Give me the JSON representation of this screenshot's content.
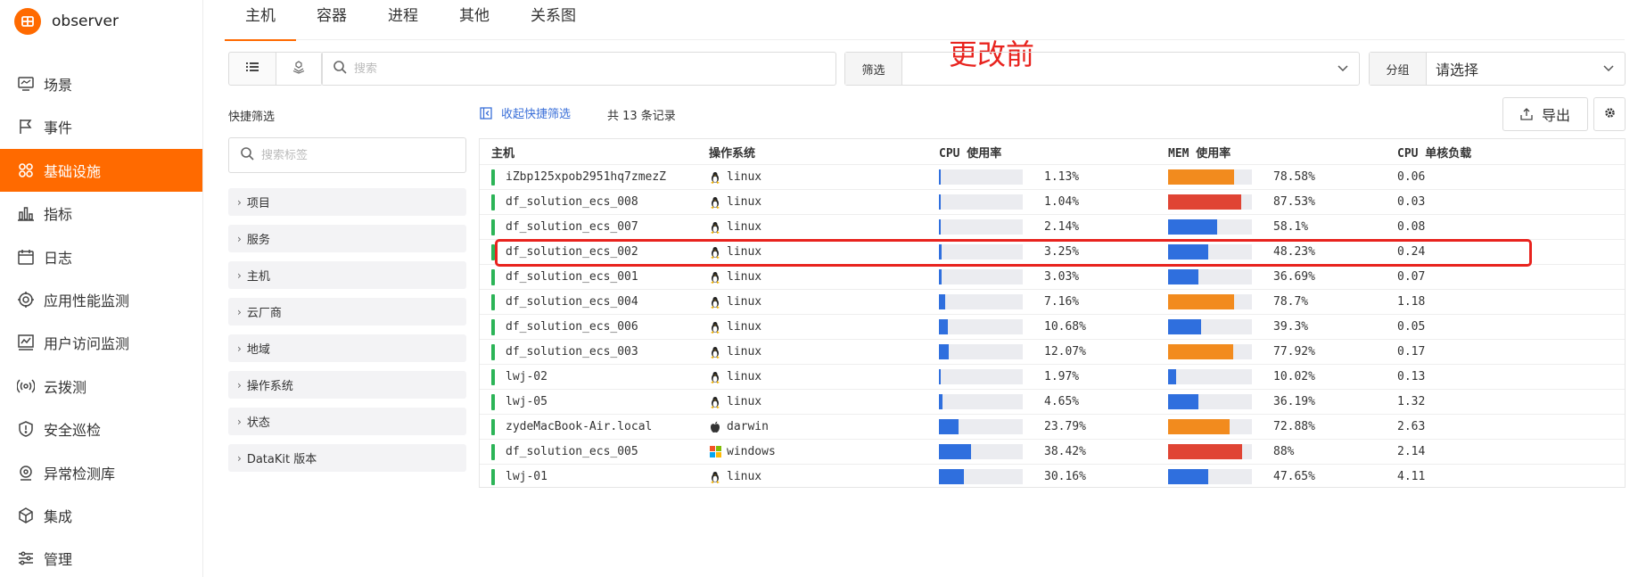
{
  "app": {
    "title": "observer"
  },
  "annotation": "更改前",
  "sidebar": {
    "items": [
      {
        "label": "场景",
        "icon": "monitor-icon",
        "active": false
      },
      {
        "label": "事件",
        "icon": "flag-icon",
        "active": false
      },
      {
        "label": "基础设施",
        "icon": "grid-icon",
        "active": true
      },
      {
        "label": "指标",
        "icon": "bar-chart-icon",
        "active": false
      },
      {
        "label": "日志",
        "icon": "calendar-icon",
        "active": false
      },
      {
        "label": "应用性能监测",
        "icon": "target-icon",
        "active": false
      },
      {
        "label": "用户访问监测",
        "icon": "chart-screen-icon",
        "active": false
      },
      {
        "label": "云拨测",
        "icon": "broadcast-icon",
        "active": false
      },
      {
        "label": "安全巡检",
        "icon": "shield-icon",
        "active": false
      },
      {
        "label": "异常检测库",
        "icon": "radar-icon",
        "active": false
      },
      {
        "label": "集成",
        "icon": "cube-icon",
        "active": false
      },
      {
        "label": "管理",
        "icon": "sliders-icon",
        "active": false
      }
    ]
  },
  "tabs": [
    {
      "label": "主机",
      "active": true
    },
    {
      "label": "容器",
      "active": false
    },
    {
      "label": "进程",
      "active": false
    },
    {
      "label": "其他",
      "active": false
    },
    {
      "label": "关系图",
      "active": false
    }
  ],
  "toolbar": {
    "search_placeholder": "搜索",
    "filter_label": "筛选",
    "group_label": "分组",
    "group_value": "请选择",
    "export_label": "导出"
  },
  "quick_filter": {
    "title": "快捷筛选",
    "search_placeholder": "搜索标签",
    "collapse_label": "收起快捷筛选",
    "items": [
      "项目",
      "服务",
      "主机",
      "云厂商",
      "地域",
      "操作系统",
      "状态",
      "DataKit 版本"
    ]
  },
  "record_count": "共 13 条记录",
  "table": {
    "columns": [
      "主机",
      "操作系统",
      "CPU 使用率",
      "MEM 使用率",
      "CPU 单核负载"
    ],
    "colors": {
      "status": "#2cb457",
      "blue": "#2f6fde",
      "orange": "#f28b1e",
      "red": "#e04434"
    },
    "rows": [
      {
        "host": "iZbp125xpob2951hq7zmezZ",
        "os": "linux",
        "os_icon": "linux-icon",
        "cpu": "1.13%",
        "cpu_val": 1.13,
        "mem": "78.58%",
        "mem_val": 78.58,
        "mem_color": "#f28b1e",
        "load": "0.06"
      },
      {
        "host": "df_solution_ecs_008",
        "os": "linux",
        "os_icon": "linux-icon",
        "cpu": "1.04%",
        "cpu_val": 1.04,
        "mem": "87.53%",
        "mem_val": 87.53,
        "mem_color": "#e04434",
        "load": "0.03"
      },
      {
        "host": "df_solution_ecs_007",
        "os": "linux",
        "os_icon": "linux-icon",
        "cpu": "2.14%",
        "cpu_val": 2.14,
        "mem": "58.1%",
        "mem_val": 58.1,
        "mem_color": "#2f6fde",
        "load": "0.08"
      },
      {
        "host": "df_solution_ecs_002",
        "os": "linux",
        "os_icon": "linux-icon",
        "cpu": "3.25%",
        "cpu_val": 3.25,
        "mem": "48.23%",
        "mem_val": 48.23,
        "mem_color": "#2f6fde",
        "load": "0.24"
      },
      {
        "host": "df_solution_ecs_001",
        "os": "linux",
        "os_icon": "linux-icon",
        "cpu": "3.03%",
        "cpu_val": 3.03,
        "mem": "36.69%",
        "mem_val": 36.69,
        "mem_color": "#2f6fde",
        "load": "0.07"
      },
      {
        "host": "df_solution_ecs_004",
        "os": "linux",
        "os_icon": "linux-icon",
        "cpu": "7.16%",
        "cpu_val": 7.16,
        "mem": "78.7%",
        "mem_val": 78.7,
        "mem_color": "#f28b1e",
        "load": "1.18"
      },
      {
        "host": "df_solution_ecs_006",
        "os": "linux",
        "os_icon": "linux-icon",
        "cpu": "10.68%",
        "cpu_val": 10.68,
        "mem": "39.3%",
        "mem_val": 39.3,
        "mem_color": "#2f6fde",
        "load": "0.05"
      },
      {
        "host": "df_solution_ecs_003",
        "os": "linux",
        "os_icon": "linux-icon",
        "cpu": "12.07%",
        "cpu_val": 12.07,
        "mem": "77.92%",
        "mem_val": 77.92,
        "mem_color": "#f28b1e",
        "load": "0.17"
      },
      {
        "host": "lwj-02",
        "os": "linux",
        "os_icon": "linux-icon",
        "cpu": "1.97%",
        "cpu_val": 1.97,
        "mem": "10.02%",
        "mem_val": 10.02,
        "mem_color": "#2f6fde",
        "load": "0.13"
      },
      {
        "host": "lwj-05",
        "os": "linux",
        "os_icon": "linux-icon",
        "cpu": "4.65%",
        "cpu_val": 4.65,
        "mem": "36.19%",
        "mem_val": 36.19,
        "mem_color": "#2f6fde",
        "load": "1.32"
      },
      {
        "host": "zydeMacBook-Air.local",
        "os": "darwin",
        "os_icon": "apple-icon",
        "cpu": "23.79%",
        "cpu_val": 23.79,
        "mem": "72.88%",
        "mem_val": 72.88,
        "mem_color": "#f28b1e",
        "load": "2.63"
      },
      {
        "host": "df_solution_ecs_005",
        "os": "windows",
        "os_icon": "windows-icon",
        "cpu": "38.42%",
        "cpu_val": 38.42,
        "mem": "88%",
        "mem_val": 88,
        "mem_color": "#e04434",
        "load": "2.14"
      },
      {
        "host": "lwj-01",
        "os": "linux",
        "os_icon": "linux-icon",
        "cpu": "30.16%",
        "cpu_val": 30.16,
        "mem": "47.65%",
        "mem_val": 47.65,
        "mem_color": "#2f6fde",
        "load": "4.11"
      }
    ]
  }
}
